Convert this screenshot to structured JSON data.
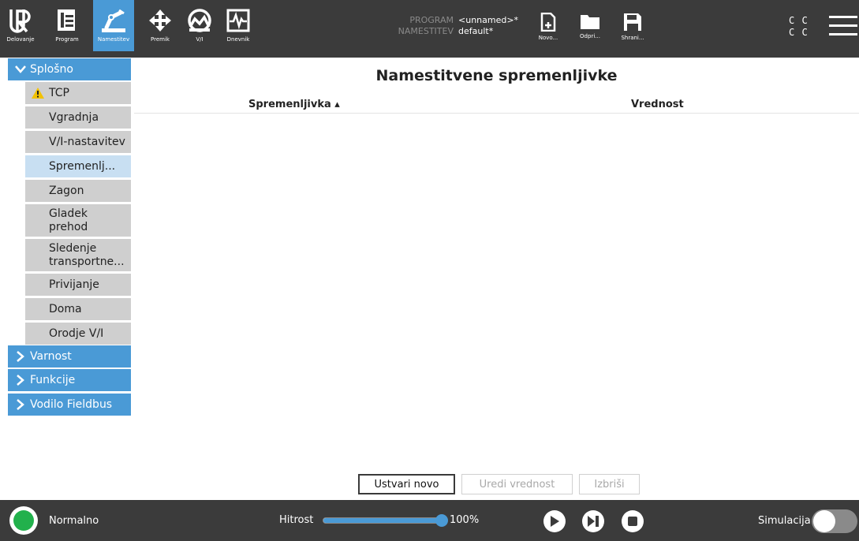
{
  "topbar": {
    "tabs": [
      {
        "label": "Delovanje",
        "icon": "ur-logo-icon"
      },
      {
        "label": "Program",
        "icon": "program-icon"
      },
      {
        "label": "Namestitev",
        "icon": "installation-icon",
        "active": true
      },
      {
        "label": "Premik",
        "icon": "move-icon"
      },
      {
        "label": "V/I",
        "icon": "io-icon"
      },
      {
        "label": "Dnevnik",
        "icon": "log-icon"
      }
    ],
    "program_key": "PROGRAM",
    "program_value": "<unnamed>*",
    "installation_key": "NAMESTITEV",
    "installation_value": "default*",
    "file_buttons": [
      {
        "label": "Novo...",
        "icon": "new-file-icon"
      },
      {
        "label": "Odpri...",
        "icon": "open-folder-icon"
      },
      {
        "label": "Shrani...",
        "icon": "save-icon"
      }
    ],
    "cc_line1": "C C",
    "cc_line2": "C C"
  },
  "nav": {
    "sections": [
      {
        "label": "Splošno",
        "expanded": true
      },
      {
        "label": "Varnost",
        "expanded": false
      },
      {
        "label": "Funkcije",
        "expanded": false
      },
      {
        "label": "Vodilo Fieldbus",
        "expanded": false
      }
    ],
    "items": [
      {
        "label": "TCP",
        "warning": true
      },
      {
        "label": "Vgradnja"
      },
      {
        "label": "V/I-nastavitev"
      },
      {
        "label": "Spremenlj...",
        "active": true
      },
      {
        "label": "Zagon"
      },
      {
        "label": "Gladek prehod"
      },
      {
        "label": "Sledenje transportne..."
      },
      {
        "label": "Privijanje"
      },
      {
        "label": "Doma"
      },
      {
        "label": "Orodje V/I"
      }
    ]
  },
  "main": {
    "title": "Namestitvene spremenljivke",
    "col_variable": "Spremenljivka ▴",
    "col_value": "Vrednost",
    "rows": [],
    "btn_new": "Ustvari novo",
    "btn_edit": "Uredi vrednost",
    "btn_delete": "Izbriši"
  },
  "bottom": {
    "status": "Normalno",
    "speed_label": "Hitrost",
    "speed_percent": 100,
    "speed_text": "100%",
    "simulation_label": "Simulacija",
    "simulation_on": false
  },
  "colors": {
    "accent": "#4a9ad6",
    "bar_bg": "#3b3b3b",
    "status_ok": "#22b14c",
    "nav_item_bg": "#cfcfcf",
    "nav_active_bg": "#c8dff2"
  }
}
